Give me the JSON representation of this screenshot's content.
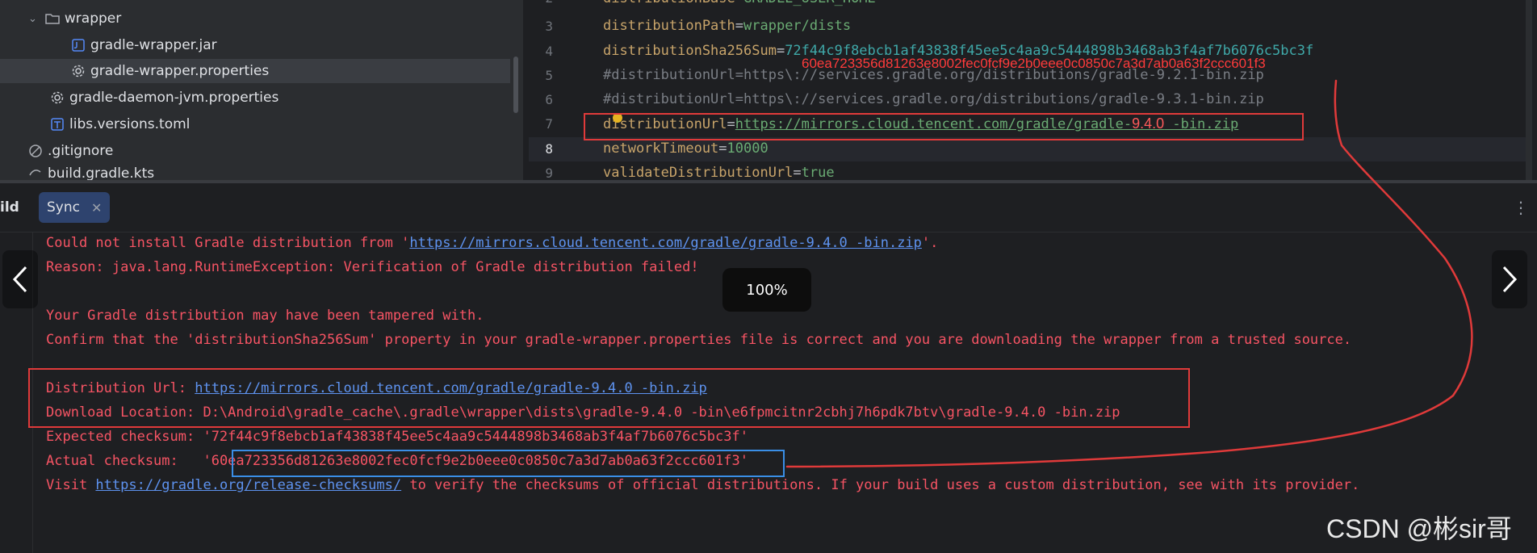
{
  "project_tree": {
    "items": [
      {
        "label": "wrapper",
        "icon": "folder-icon"
      },
      {
        "label": "gradle-wrapper.jar",
        "icon": "jar-file-icon"
      },
      {
        "label": "gradle-wrapper.properties",
        "icon": "settings-file-icon"
      },
      {
        "label": "gradle-daemon-jvm.properties",
        "icon": "settings-file-icon"
      },
      {
        "label": "libs.versions.toml",
        "icon": "toml-file-icon"
      },
      {
        "label": ".gitignore",
        "icon": "ignore-file-icon"
      },
      {
        "label": "build.gradle.kts",
        "icon": "gradle-file-icon"
      }
    ]
  },
  "editor": {
    "lines": [
      {
        "num": "2",
        "key": "distributionBase",
        "val": "GRADLE_USER_HOME"
      },
      {
        "num": "3",
        "key": "distributionPath",
        "val": "wrapper/dists"
      },
      {
        "num": "4",
        "key": "distributionSha256Sum",
        "val": "72f44c9f8ebcb1af43838f45ee5c4aa9c5444898b3468ab3f4af7b6076c5bc3f"
      },
      {
        "num": "5",
        "text": "#distributionUrl=https\\://services.gradle.org/distributions/gradle-9.2.1-bin.zip"
      },
      {
        "num": "6",
        "text": "#distributionUrl=https\\://services.gradle.org/distributions/gradle-9.3.1-bin.zip"
      },
      {
        "num": "7",
        "key": "distributionUrl",
        "url_prefix": "https://mirrors.cloud.tencent.com/gradle/gradle-",
        "url_version": "9.4.0",
        "url_suffix": " -bin.zip"
      },
      {
        "num": "8",
        "key": "networkTimeout",
        "val": "10000"
      },
      {
        "num": "9",
        "key": "validateDistributionUrl",
        "val": "true"
      }
    ]
  },
  "annotation_checksum": "60ea723356d81263e8002fec0fcf9e2b0eee0c0850c7a3d7ab0a63f2ccc601f3",
  "build_panel": {
    "tab_build": "ild",
    "tab_sync": "Sync",
    "zoom": "100%",
    "console": {
      "l1_prefix": "Could not install Gradle distribution from '",
      "l1_url": "https://mirrors.cloud.tencent.com/gradle/gradle-9.4.0 -bin.zip",
      "l1_suffix": "'.",
      "l2": "Reason: java.lang.RuntimeException: Verification of Gradle distribution failed!",
      "l3": "Your Gradle distribution may have been tampered with.",
      "l4": "Confirm that the 'distributionSha256Sum' property in your gradle-wrapper.properties file is correct and you are downloading the wrapper from a trusted source.",
      "l5_label": "Distribution Url: ",
      "l5_url": "https://mirrors.cloud.tencent.com/gradle/gradle-9.4.0 -bin.zip",
      "l6": "Download Location: D:\\Android\\gradle_cache\\.gradle\\wrapper\\dists\\gradle-9.4.0 -bin\\e6fpmcitnr2cbhj7h6pdk7btv\\gradle-9.4.0 -bin.zip",
      "l7": "Expected checksum: '72f44c9f8ebcb1af43838f45ee5c4aa9c5444898b3468ab3f4af7b6076c5bc3f'",
      "l8_label": "Actual checksum:   '",
      "l8_value": "60ea723356d81263e8002fec0fcf9e2b0eee0c0850c7a3d7ab0a63f2ccc601f3",
      "l8_suffix": "'",
      "l9_prefix": "Visit ",
      "l9_url": "https://gradle.org/release-checksums/",
      "l9_suffix": " to verify the checksums of official distributions. If your build uses a custom distribution, see with its provider."
    }
  },
  "watermark": "CSDN @彬sir哥",
  "colors": {
    "error": "#f75464",
    "link": "#5e93f0",
    "annotation": "#ff3b3b",
    "tab_active": "#2e436e"
  }
}
